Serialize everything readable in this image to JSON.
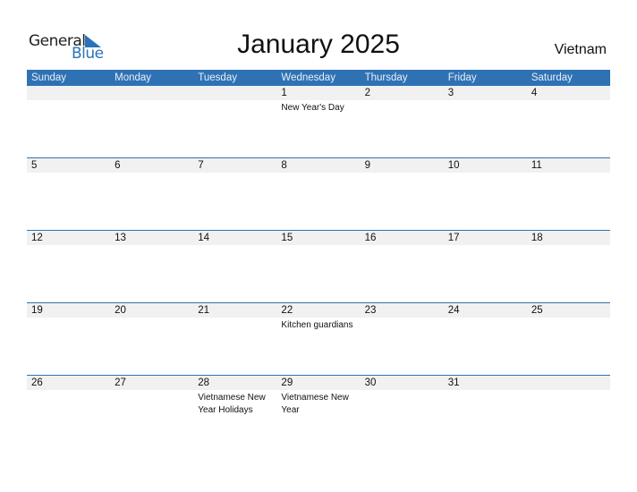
{
  "logo": {
    "word1": "General",
    "word2": "Blue"
  },
  "title": "January 2025",
  "country": "Vietnam",
  "colors": {
    "accent": "#2f72b4",
    "band": "#f1f1f1"
  },
  "weekdays": [
    "Sunday",
    "Monday",
    "Tuesday",
    "Wednesday",
    "Thursday",
    "Friday",
    "Saturday"
  ],
  "weeks": [
    [
      {
        "d": ""
      },
      {
        "d": ""
      },
      {
        "d": ""
      },
      {
        "d": "1",
        "e": "New Year's Day"
      },
      {
        "d": "2"
      },
      {
        "d": "3"
      },
      {
        "d": "4"
      }
    ],
    [
      {
        "d": "5"
      },
      {
        "d": "6"
      },
      {
        "d": "7"
      },
      {
        "d": "8"
      },
      {
        "d": "9"
      },
      {
        "d": "10"
      },
      {
        "d": "11"
      }
    ],
    [
      {
        "d": "12"
      },
      {
        "d": "13"
      },
      {
        "d": "14"
      },
      {
        "d": "15"
      },
      {
        "d": "16"
      },
      {
        "d": "17"
      },
      {
        "d": "18"
      }
    ],
    [
      {
        "d": "19"
      },
      {
        "d": "20"
      },
      {
        "d": "21"
      },
      {
        "d": "22",
        "e": "Kitchen guardians"
      },
      {
        "d": "23"
      },
      {
        "d": "24"
      },
      {
        "d": "25"
      }
    ],
    [
      {
        "d": "26"
      },
      {
        "d": "27"
      },
      {
        "d": "28",
        "e": "Vietnamese New Year Holidays"
      },
      {
        "d": "29",
        "e": "Vietnamese New Year"
      },
      {
        "d": "30"
      },
      {
        "d": "31"
      },
      {
        "d": ""
      }
    ]
  ]
}
